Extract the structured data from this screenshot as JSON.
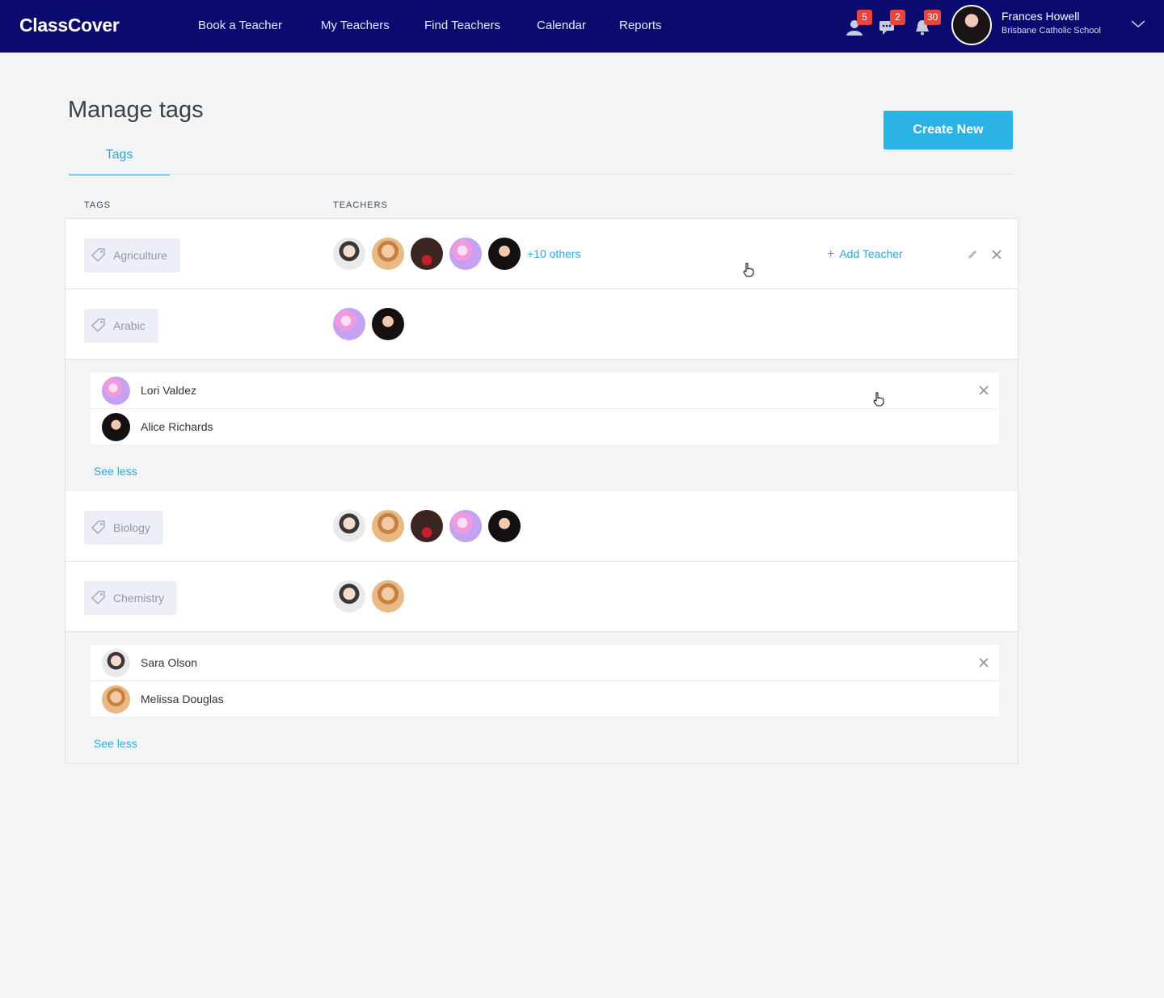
{
  "nav": {
    "logo": "ClassCover",
    "links": [
      "Book a Teacher",
      "My Teachers",
      "Find Teachers",
      "Calendar",
      "Reports"
    ],
    "badges": {
      "requests": "5",
      "messages": "2",
      "notifications": "30"
    },
    "user": {
      "name": "Frances Howell",
      "school": "Brisbane Catholic School"
    }
  },
  "page": {
    "title": "Manage tags",
    "create_label": "Create New",
    "tab_label": "Tags",
    "col_tags": "TAGS",
    "col_teachers": "TEACHERS"
  },
  "rows": [
    {
      "tag": "Agriculture",
      "others": "+10 others",
      "add_teacher": "Add Teacher"
    },
    {
      "tag": "Arabic"
    },
    {
      "tag": "Biology"
    },
    {
      "tag": "Chemistry"
    }
  ],
  "expanded": {
    "arabic": [
      {
        "name": "Lori Valdez"
      },
      {
        "name": "Alice Richards"
      }
    ],
    "chemistry": [
      {
        "name": "Sara Olson"
      },
      {
        "name": "Melissa Douglas"
      }
    ],
    "see_less": "See less"
  },
  "colors": {
    "nav": "#0b0a6e",
    "accent": "#2bb3e5",
    "badge": "#e8453c"
  }
}
